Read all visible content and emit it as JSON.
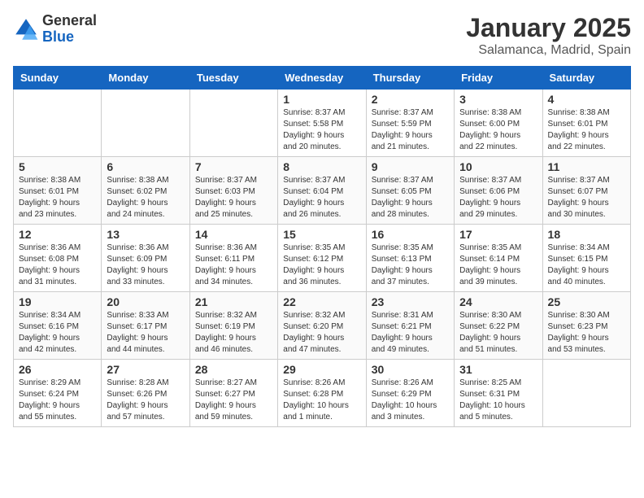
{
  "logo": {
    "general": "General",
    "blue": "Blue"
  },
  "title": {
    "month_year": "January 2025",
    "location": "Salamanca, Madrid, Spain"
  },
  "weekdays": [
    "Sunday",
    "Monday",
    "Tuesday",
    "Wednesday",
    "Thursday",
    "Friday",
    "Saturday"
  ],
  "weeks": [
    [
      {
        "day": "",
        "info": ""
      },
      {
        "day": "",
        "info": ""
      },
      {
        "day": "",
        "info": ""
      },
      {
        "day": "1",
        "info": "Sunrise: 8:37 AM\nSunset: 5:58 PM\nDaylight: 9 hours\nand 20 minutes."
      },
      {
        "day": "2",
        "info": "Sunrise: 8:37 AM\nSunset: 5:59 PM\nDaylight: 9 hours\nand 21 minutes."
      },
      {
        "day": "3",
        "info": "Sunrise: 8:38 AM\nSunset: 6:00 PM\nDaylight: 9 hours\nand 22 minutes."
      },
      {
        "day": "4",
        "info": "Sunrise: 8:38 AM\nSunset: 6:01 PM\nDaylight: 9 hours\nand 22 minutes."
      }
    ],
    [
      {
        "day": "5",
        "info": "Sunrise: 8:38 AM\nSunset: 6:01 PM\nDaylight: 9 hours\nand 23 minutes."
      },
      {
        "day": "6",
        "info": "Sunrise: 8:38 AM\nSunset: 6:02 PM\nDaylight: 9 hours\nand 24 minutes."
      },
      {
        "day": "7",
        "info": "Sunrise: 8:37 AM\nSunset: 6:03 PM\nDaylight: 9 hours\nand 25 minutes."
      },
      {
        "day": "8",
        "info": "Sunrise: 8:37 AM\nSunset: 6:04 PM\nDaylight: 9 hours\nand 26 minutes."
      },
      {
        "day": "9",
        "info": "Sunrise: 8:37 AM\nSunset: 6:05 PM\nDaylight: 9 hours\nand 28 minutes."
      },
      {
        "day": "10",
        "info": "Sunrise: 8:37 AM\nSunset: 6:06 PM\nDaylight: 9 hours\nand 29 minutes."
      },
      {
        "day": "11",
        "info": "Sunrise: 8:37 AM\nSunset: 6:07 PM\nDaylight: 9 hours\nand 30 minutes."
      }
    ],
    [
      {
        "day": "12",
        "info": "Sunrise: 8:36 AM\nSunset: 6:08 PM\nDaylight: 9 hours\nand 31 minutes."
      },
      {
        "day": "13",
        "info": "Sunrise: 8:36 AM\nSunset: 6:09 PM\nDaylight: 9 hours\nand 33 minutes."
      },
      {
        "day": "14",
        "info": "Sunrise: 8:36 AM\nSunset: 6:11 PM\nDaylight: 9 hours\nand 34 minutes."
      },
      {
        "day": "15",
        "info": "Sunrise: 8:35 AM\nSunset: 6:12 PM\nDaylight: 9 hours\nand 36 minutes."
      },
      {
        "day": "16",
        "info": "Sunrise: 8:35 AM\nSunset: 6:13 PM\nDaylight: 9 hours\nand 37 minutes."
      },
      {
        "day": "17",
        "info": "Sunrise: 8:35 AM\nSunset: 6:14 PM\nDaylight: 9 hours\nand 39 minutes."
      },
      {
        "day": "18",
        "info": "Sunrise: 8:34 AM\nSunset: 6:15 PM\nDaylight: 9 hours\nand 40 minutes."
      }
    ],
    [
      {
        "day": "19",
        "info": "Sunrise: 8:34 AM\nSunset: 6:16 PM\nDaylight: 9 hours\nand 42 minutes."
      },
      {
        "day": "20",
        "info": "Sunrise: 8:33 AM\nSunset: 6:17 PM\nDaylight: 9 hours\nand 44 minutes."
      },
      {
        "day": "21",
        "info": "Sunrise: 8:32 AM\nSunset: 6:19 PM\nDaylight: 9 hours\nand 46 minutes."
      },
      {
        "day": "22",
        "info": "Sunrise: 8:32 AM\nSunset: 6:20 PM\nDaylight: 9 hours\nand 47 minutes."
      },
      {
        "day": "23",
        "info": "Sunrise: 8:31 AM\nSunset: 6:21 PM\nDaylight: 9 hours\nand 49 minutes."
      },
      {
        "day": "24",
        "info": "Sunrise: 8:30 AM\nSunset: 6:22 PM\nDaylight: 9 hours\nand 51 minutes."
      },
      {
        "day": "25",
        "info": "Sunrise: 8:30 AM\nSunset: 6:23 PM\nDaylight: 9 hours\nand 53 minutes."
      }
    ],
    [
      {
        "day": "26",
        "info": "Sunrise: 8:29 AM\nSunset: 6:24 PM\nDaylight: 9 hours\nand 55 minutes."
      },
      {
        "day": "27",
        "info": "Sunrise: 8:28 AM\nSunset: 6:26 PM\nDaylight: 9 hours\nand 57 minutes."
      },
      {
        "day": "28",
        "info": "Sunrise: 8:27 AM\nSunset: 6:27 PM\nDaylight: 9 hours\nand 59 minutes."
      },
      {
        "day": "29",
        "info": "Sunrise: 8:26 AM\nSunset: 6:28 PM\nDaylight: 10 hours\nand 1 minute."
      },
      {
        "day": "30",
        "info": "Sunrise: 8:26 AM\nSunset: 6:29 PM\nDaylight: 10 hours\nand 3 minutes."
      },
      {
        "day": "31",
        "info": "Sunrise: 8:25 AM\nSunset: 6:31 PM\nDaylight: 10 hours\nand 5 minutes."
      },
      {
        "day": "",
        "info": ""
      }
    ]
  ]
}
